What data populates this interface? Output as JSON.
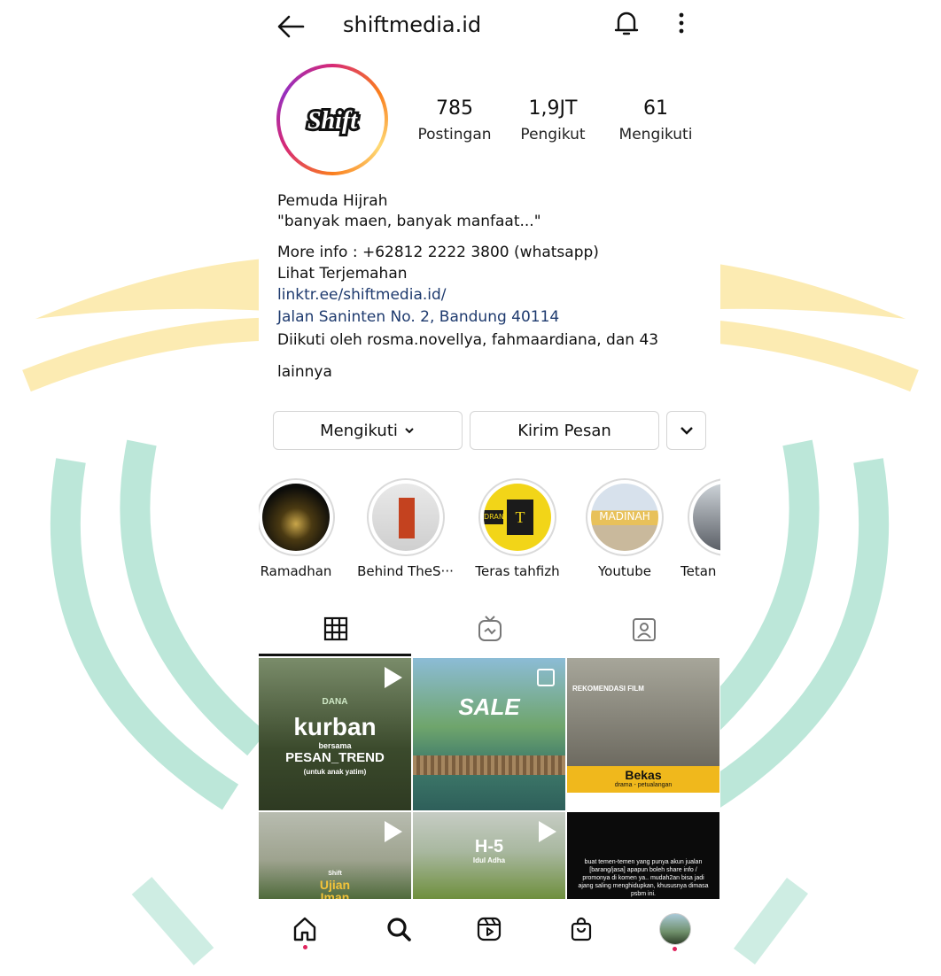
{
  "header": {
    "username": "shiftmedia.id"
  },
  "profile": {
    "logo_text": "Shift",
    "stats": [
      {
        "value": "785",
        "label": "Postingan"
      },
      {
        "value": "1,9JT",
        "label": "Pengikut"
      },
      {
        "value": "61",
        "label": "Mengikuti"
      }
    ],
    "bio_lines": {
      "name": "Pemuda Hijrah",
      "quote": "\"banyak maen, banyak manfaat...\"",
      "info": "More info : +62812 2222 3800 (whatsapp)",
      "translate": "Lihat Terjemahan",
      "link": "linktr.ee/shiftmedia.id/",
      "address": "Jalan Saninten No. 2, Bandung 40114",
      "followed_by": "Diikuti oleh rosma.novellya, fahmaardiana, dan 43",
      "followed_by_more": "lainnya"
    }
  },
  "actions": {
    "follow_label": "Mengikuti",
    "message_label": "Kirim Pesan"
  },
  "highlights": [
    {
      "label": "Ramadhan"
    },
    {
      "label": "Behind TheS···"
    },
    {
      "label": "Teras tahfizh"
    },
    {
      "label": "Youtube"
    },
    {
      "label": "Tetan"
    }
  ],
  "highlight_texts": {
    "teras_left": "DRAN",
    "teras_badge": "T",
    "youtube_text": "MADINAH"
  },
  "posts": {
    "p1_brand": "DANA",
    "p1_title": "kurban",
    "p1_sub": "bersama",
    "p1_main": "PESAN_TREND",
    "p1_note": "(untuk anak yatim)",
    "p2_title": "SALE",
    "p3_header": "REKOMENDASI FILM",
    "p3_title": "Bekas",
    "p3_sub": "drama - petualangan",
    "p4_brand": "Shift",
    "p4_title1": "Ujian",
    "p4_title2": "Iman",
    "p5_title": "H-5",
    "p5_sub": "Idul Adha",
    "p6_text": "buat temen-temen yang punya akun jualan [barang/jasa] apapun boleh share info / promonya di komen ya.. mudah2an bisa jadi ajang saling menghidupkan, khususnya dimasa psbm ini."
  },
  "colors": {
    "link": "#1e3a6e",
    "notification_dot": "#e0245e",
    "watermark_green": "#3fb993",
    "watermark_yellow": "#f7c623"
  },
  "icons": [
    "back-arrow-icon",
    "bell-icon",
    "more-vertical-icon",
    "chevron-down-icon",
    "grid-icon",
    "igtv-icon",
    "tagged-icon",
    "home-icon",
    "search-icon",
    "reels-icon",
    "shop-icon"
  ]
}
